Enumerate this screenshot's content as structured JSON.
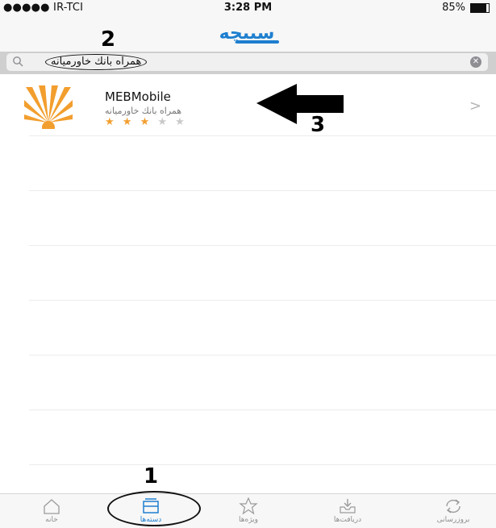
{
  "status_bar": {
    "carrier": "●●●●● IR-TCI",
    "time": "3:28 PM",
    "battery_percent": "85%",
    "battery_level": 0.85
  },
  "nav": {
    "logo_text": "سیبچه",
    "logo_color": "#1e7fcf"
  },
  "search": {
    "value": "همراه بانك خاورميانه",
    "clear_symbol": "✕"
  },
  "annotations": {
    "tabs_marker": "1",
    "search_marker": "2",
    "result_marker": "3"
  },
  "results": [
    {
      "name": "MEBMobile",
      "subtitle": "همراه بانك خاورميانه",
      "rating": 3,
      "rating_max": 5,
      "stars_on": "★ ★ ★",
      "stars_off": "★ ★",
      "chevron": ">"
    }
  ],
  "tab_bar": {
    "accent_color": "#1e7fcf",
    "tabs": [
      {
        "label": "خانه",
        "icon": "home-icon"
      },
      {
        "label": "دسته‌ها",
        "icon": "categories-icon",
        "active": true
      },
      {
        "label": "ویژه‌ها",
        "icon": "star-icon"
      },
      {
        "label": "دریافت‌ها",
        "icon": "download-icon"
      },
      {
        "label": "بروزرسانی",
        "icon": "refresh-icon"
      }
    ]
  }
}
